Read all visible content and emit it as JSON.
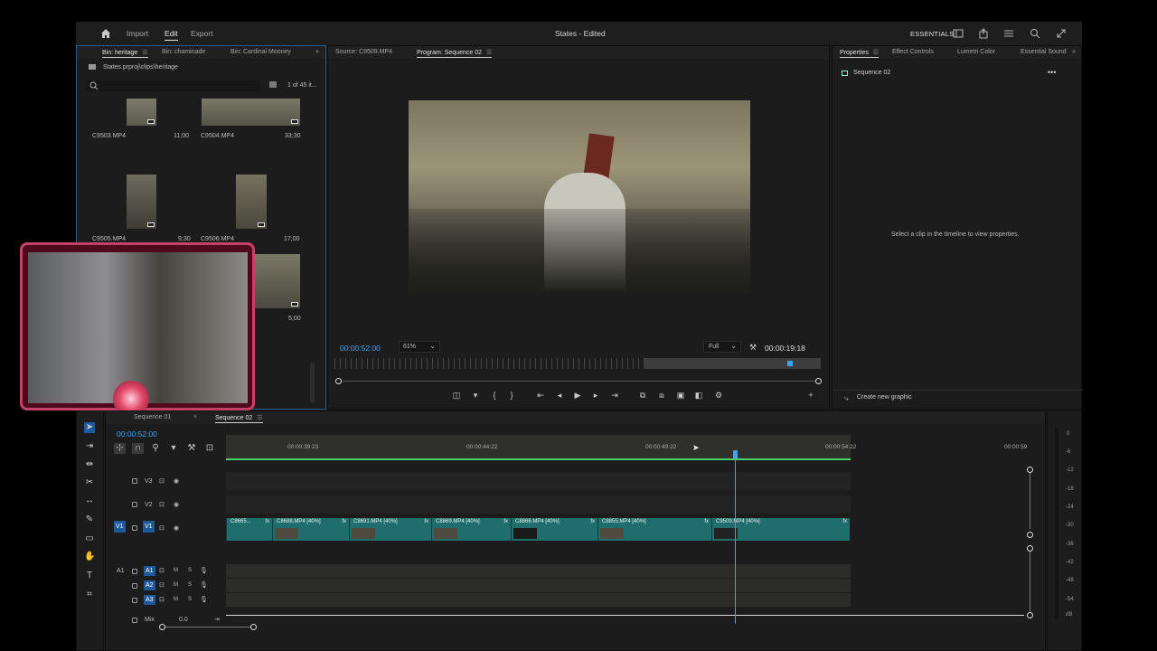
{
  "topbar": {
    "menu": [
      "Import",
      "Edit",
      "Export"
    ],
    "title": "States - Edited",
    "workspace": "ESSENTIALS"
  },
  "project": {
    "tabs": [
      "Bin: heritage",
      "Bin: chaminade",
      "Bin: Cardinal Mooney"
    ],
    "path": "States.prproj\\clips\\heritage",
    "count": "1 of 45 it...",
    "items": [
      {
        "name": "C9503.MP4",
        "duration": "11;00"
      },
      {
        "name": "C9504.MP4",
        "duration": "33;30"
      },
      {
        "name": "C9505.MP4",
        "duration": "9;30"
      },
      {
        "name": "C9506.MP4",
        "duration": "17;00"
      },
      {
        "name": "",
        "duration": "5;00"
      }
    ]
  },
  "monitor": {
    "source_tab": "Source: C9509.MP4",
    "program_tab": "Program: Sequence 02",
    "timecode": "00:00:52:00",
    "zoom": "61%",
    "quality": "Full",
    "duration": "00:00:19:18"
  },
  "properties": {
    "tabs": [
      "Properties",
      "Effect Controls",
      "Lumetri Color",
      "Essential Sound"
    ],
    "sequence": "Sequence 02",
    "hint": "Select a clip in the timeline to view properties.",
    "create_graphic": "Create new graphic"
  },
  "timeline": {
    "tabs": [
      "Sequence 01",
      "Sequence 02"
    ],
    "timecode": "00:00:52:00",
    "ruler": [
      "00:00:39:23",
      "00:00:44:22",
      "00:00:49:22",
      "00:00:54:22",
      "00:00:59"
    ],
    "video_tracks": [
      {
        "name": "V3"
      },
      {
        "name": "V2"
      },
      {
        "name": "V1",
        "source": "V1"
      }
    ],
    "audio_tracks": [
      {
        "name": "A1",
        "source": "A1"
      },
      {
        "name": "A2"
      },
      {
        "name": "A3"
      }
    ],
    "track_letters": {
      "mute": "M",
      "solo": "S"
    },
    "mix": {
      "label": "Mix",
      "value": "0.0"
    },
    "clips": [
      {
        "label": "C8665...",
        "fx": "fx"
      },
      {
        "label": "C8688.MP4 [40%]",
        "fx": "fx"
      },
      {
        "label": "C8691.MP4 [40%]",
        "fx": "fx"
      },
      {
        "label": "C8869.MP4 [40%]",
        "fx": "fx"
      },
      {
        "label": "C8866.MP4 [40%]",
        "fx": "fx"
      },
      {
        "label": "C8855.MP4 [40%]",
        "fx": "fx"
      },
      {
        "label": "C9509.MP4 [40%]",
        "fx": "fx"
      }
    ],
    "meter_labels": [
      "0",
      "-6",
      "-12",
      "-18",
      "-24",
      "-30",
      "-36",
      "-42",
      "-48",
      "-54",
      "dB"
    ]
  }
}
